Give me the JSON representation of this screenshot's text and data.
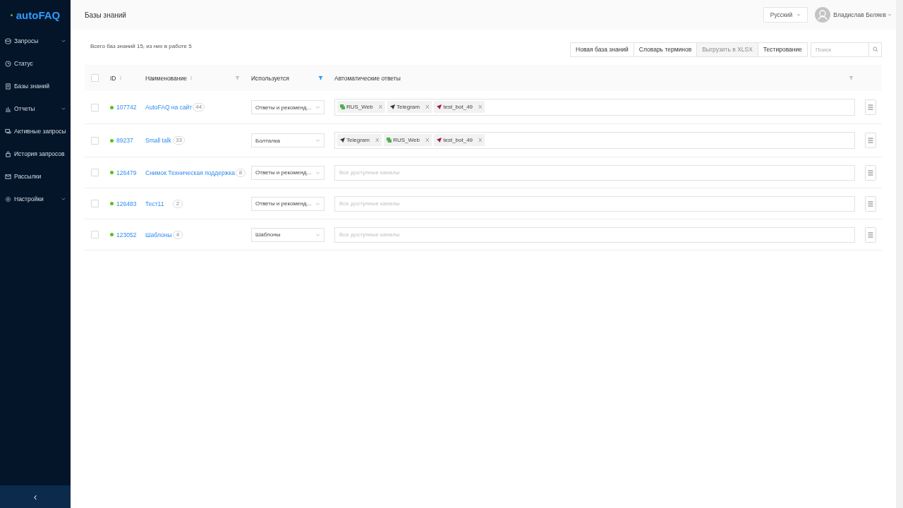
{
  "sidebar": {
    "logo": "autoFAQ",
    "collapse_label": "‹",
    "items": [
      {
        "label": "Запросы",
        "kind": "db",
        "expandable": true
      },
      {
        "label": "Статус",
        "kind": "clock",
        "expandable": false
      },
      {
        "label": "Базы знаний",
        "kind": "book",
        "expandable": false
      },
      {
        "label": "Отчеты",
        "kind": "chart",
        "expandable": true
      },
      {
        "label": "Активные запросы",
        "kind": "chat",
        "expandable": false
      },
      {
        "label": "История запросов",
        "kind": "lock",
        "expandable": false
      },
      {
        "label": "Рассылки",
        "kind": "mail",
        "expandable": false
      },
      {
        "label": "Настройки",
        "kind": "gear",
        "expandable": true
      }
    ]
  },
  "header": {
    "title": "Базы знаний",
    "language": "Русский",
    "user": "Владислав Беляев"
  },
  "summary": "Всего баз знаний 15, из них в работе 5",
  "toolbar": {
    "buttons": [
      {
        "label": "Новая база знаний",
        "disabled": false
      },
      {
        "label": "Словарь терминов",
        "disabled": false
      },
      {
        "label": "Выгрузить в XLSX",
        "disabled": true
      },
      {
        "label": "Тестирование",
        "disabled": false
      }
    ],
    "search": {
      "placeholder": "Поиск"
    }
  },
  "table": {
    "select_all_checked": false,
    "columns": [
      {
        "label": "ID",
        "sortable": true
      },
      {
        "label": "Наименование",
        "sortable": true,
        "filter_active": false
      },
      {
        "label": "Используется",
        "sortable": false,
        "filter_active": true
      },
      {
        "label": "Автоматические ответы",
        "sortable": false,
        "filter_active": false
      }
    ],
    "rows": [
      {
        "checked": false,
        "color": "#52c41a",
        "id": "107742",
        "name": "AutoFAQ на сайт",
        "count": "44",
        "usage": "Ответы и рекоменд...",
        "channels": [
          {
            "name": "RUS_Web",
            "kind": "web",
            "color": "#4caf50",
            "remove": "X"
          },
          {
            "name": "Telegram",
            "kind": "plane",
            "color": "#333333",
            "remove": "X"
          },
          {
            "name": "test_bot_49",
            "kind": "plane",
            "color": "#a0153e",
            "remove": "X"
          }
        ]
      },
      {
        "checked": false,
        "color": "#52c41a",
        "id": "89237",
        "name": "Small talk",
        "count": "33",
        "usage": "Болталка",
        "channels": [
          {
            "name": "Telegram",
            "kind": "plane",
            "color": "#333333",
            "remove": "X"
          },
          {
            "name": "RUS_Web",
            "kind": "web",
            "color": "#4caf50",
            "remove": "X"
          },
          {
            "name": "test_bot_49",
            "kind": "plane",
            "color": "#a0153e",
            "remove": "X"
          }
        ]
      },
      {
        "checked": false,
        "color": "#52c41a",
        "id": "126479",
        "name": "Снимок Техническая поддержка",
        "count": "8",
        "usage": "Ответы и рекоменд...",
        "channels_placeholder": "Все доступные каналы",
        "channels": []
      },
      {
        "checked": false,
        "color": "#52c41a",
        "id": "126483",
        "name": "Тест11",
        "count": "2",
        "usage": "Ответы и рекоменд...",
        "channels_placeholder": "Все доступные каналы",
        "channels": []
      },
      {
        "checked": false,
        "color": "#52c41a",
        "id": "123052",
        "name": "Шаблоны",
        "count": "4",
        "usage": "Шаблоны",
        "channels_placeholder": "Все доступные каналы",
        "channels": []
      }
    ]
  }
}
